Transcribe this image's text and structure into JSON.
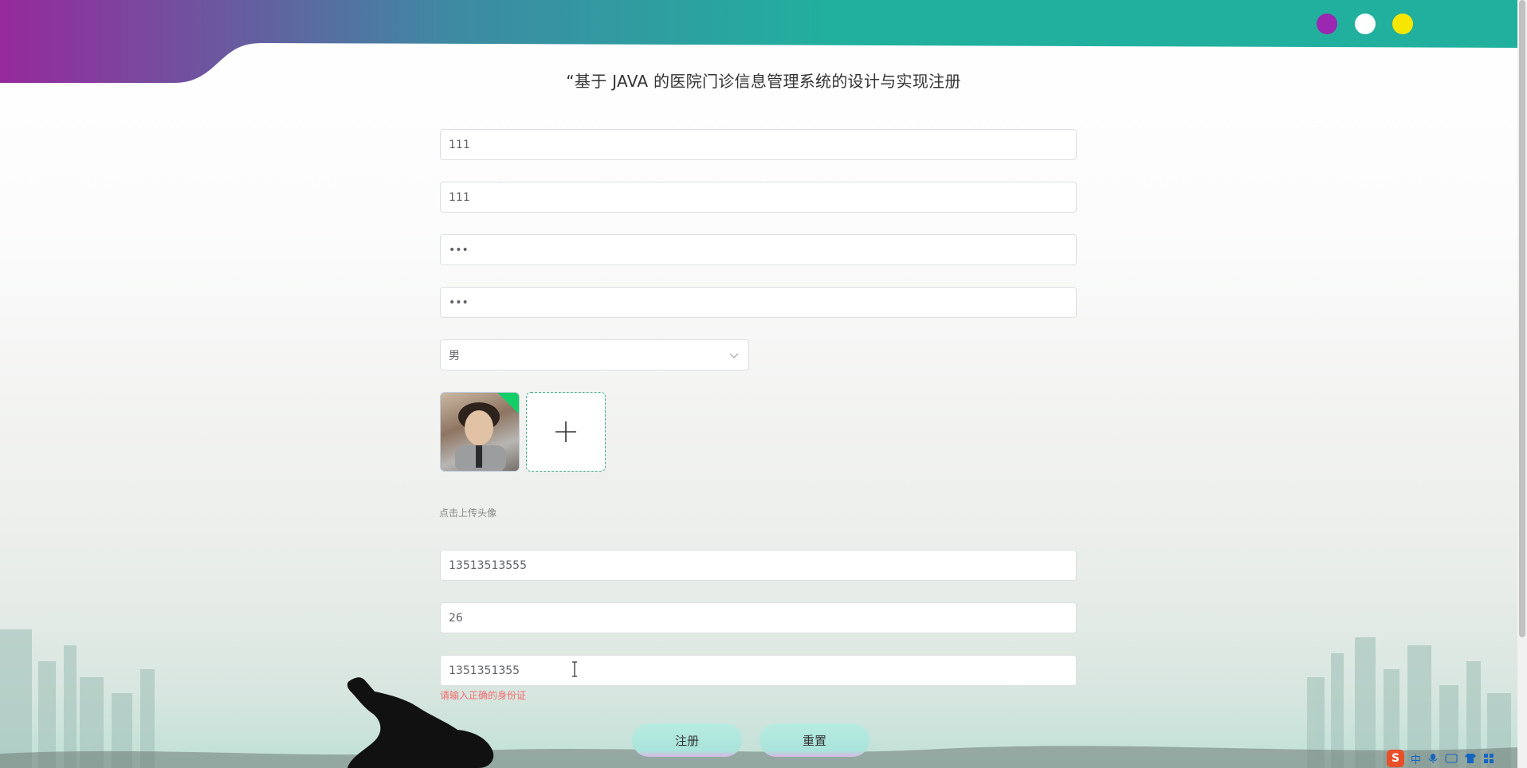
{
  "theme": {
    "colors": [
      "#9c27b0",
      "#ffffff",
      "#f7e600"
    ],
    "header_gradient": [
      "#96299c",
      "#21b09e"
    ]
  },
  "page": {
    "title": "“基于 JAVA 的医院门诊信息管理系统的设计与实现注册"
  },
  "form": {
    "account_value": "111",
    "name_value": "111",
    "password_value": "•••",
    "confirm_password_value": "•••",
    "gender_value": "男",
    "upload_hint": "点击上传头像",
    "phone_value": "13513513555",
    "age_value": "26",
    "id_card_value": "1351351355",
    "id_card_error": "请输入正确的身份证",
    "register_label": "注册",
    "reset_label": "重置"
  },
  "ime": {
    "logo": "S",
    "mode": "中"
  }
}
